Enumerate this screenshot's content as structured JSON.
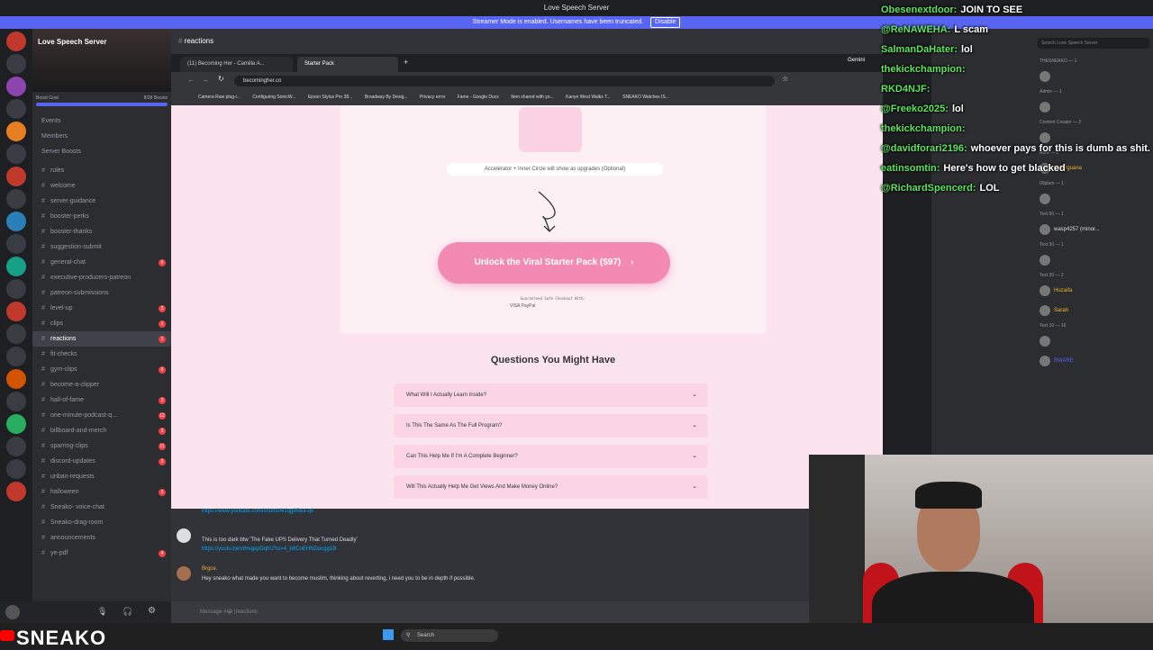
{
  "window": {
    "title": "Love Speech Server"
  },
  "streamer_banner": {
    "text": "Streamer Mode is enabled. Usernames have been truncated.",
    "disable": "Disable"
  },
  "server": {
    "name": "Love Speech Server",
    "boost_goal": "Boost Goal",
    "boost_count": "8/28 Boosts"
  },
  "nav": [
    "Events",
    "Members",
    "Server Boosts"
  ],
  "channels": [
    {
      "name": "rules",
      "count": ""
    },
    {
      "name": "welcome",
      "count": ""
    },
    {
      "name": "server-guidance",
      "count": ""
    },
    {
      "name": "booster-perks",
      "count": ""
    },
    {
      "name": "booster-thanks",
      "count": ""
    },
    {
      "name": "suggestion-submit",
      "count": ""
    },
    {
      "name": "general-chat",
      "count": "6"
    },
    {
      "name": "executive-producers-patreon",
      "count": ""
    },
    {
      "name": "patreon-submissions",
      "count": ""
    },
    {
      "name": "level-up",
      "count": "3"
    },
    {
      "name": "clips",
      "count": "1"
    },
    {
      "name": "reactions",
      "count": "1"
    },
    {
      "name": "fit-checks",
      "count": ""
    },
    {
      "name": "gym-clips",
      "count": "6"
    },
    {
      "name": "become-a-clipper",
      "count": ""
    },
    {
      "name": "hall-of-fame",
      "count": "3"
    },
    {
      "name": "one-minute-podcast-q...",
      "count": "12"
    },
    {
      "name": "billboard-and-merch",
      "count": "3"
    },
    {
      "name": "sparring-clips",
      "count": "11"
    },
    {
      "name": "discord-updates",
      "count": "3"
    },
    {
      "name": "unban-requests",
      "count": ""
    },
    {
      "name": "halloween",
      "count": "3"
    },
    {
      "name": "Sneako- voice-chat",
      "count": ""
    },
    {
      "name": "Sneako-drag-room",
      "count": ""
    },
    {
      "name": "announcements",
      "count": ""
    },
    {
      "name": "ye-pdf",
      "count": "4"
    }
  ],
  "channel_header": "reactions",
  "browser": {
    "tab1": "(11) Becoming Her - Camilla A...",
    "tab2": "Starter Pack",
    "url": "becomingher.co",
    "gemini": "Gemini",
    "bookmarks": [
      "Camera Raw plug-i...",
      "Configuring SonicW...",
      "Epson Stylus Pro 38...",
      "Broadway By Desig...",
      "Privacy error",
      "Fame - Google Docs",
      "Item shared with yo...",
      "Kanye West Walks T...",
      "SNEAKO Watches IS..."
    ]
  },
  "webpage": {
    "upgrade_note": "Accelerator + Inner Circle will show as upgrades (Optional)",
    "cta": "Unlock the Viral Starter Pack ($97)",
    "checkout_label": "Guaranteed Safe Checkout With:",
    "payments": "VISA PayPal",
    "faq_title": "Questions You Might Have",
    "faqs": [
      "What Will I Actually Learn Inside?",
      "Is This The Same As The Full Program?",
      "Can This Help Me If I'm A Complete Beginner?",
      "Will This Actually Help Me Get Views And Make Money Online?"
    ]
  },
  "chat": {
    "link1": "https://www.youtube.com/shorts/M1qg95wa-q0",
    "msg2_text": "This is too dark btw 'The Fake UPS Delivery That Turned Deadly'",
    "msg2_link": "https://youtu.be/vtHxgxpDqhU?si=4_b8CoEHNDacgg1B",
    "msg3_user": "Brgce.",
    "msg3_text": "Hey sneako what made you want to become muslim, thinking about reverting, i need you to be in depth if possible.",
    "input_placeholder": "Message #😂 |reactions"
  },
  "taskbar": {
    "search": "Search",
    "brand": "SNEAKO"
  },
  "overlay": [
    {
      "user": "Obesenextdoor:",
      "text": "JOIN TO SEE"
    },
    {
      "user": "@ReNAWEHA:",
      "text": "L scam"
    },
    {
      "user": "SalmanDaHater:",
      "text": "lol"
    },
    {
      "user": "thekickchampion:",
      "text": ""
    },
    {
      "user": "RKD4NJF:",
      "text": ""
    },
    {
      "user": "@Freeko2025:",
      "text": "lol"
    },
    {
      "user": "thekickchampion:",
      "text": ""
    },
    {
      "user": "@davidforari2196:",
      "text": "whoever pays for this is dumb as shit."
    },
    {
      "user": "eatinsomtin:",
      "text": "Here's how to get blacked"
    },
    {
      "user": "@RichardSpencerd:",
      "text": "LOL"
    }
  ],
  "members": {
    "search": "Search Love Speech Server",
    "groups": [
      "THESNEAKO — 1",
      "Admin — 1",
      "Content Creator — 2",
      "Aura — 1",
      "00plum — 1",
      "Text 50 — 1",
      "Text 30 — 1",
      "Text 20 — 2",
      "Text 10 — 16"
    ],
    "names": [
      "Silly Iguana",
      "wasp4257 (minor...",
      "Huzaifa",
      "Sarah",
      "BWARE"
    ]
  },
  "colors": {
    "accent": "#f38ab4",
    "discord_blurple": "#5865f2",
    "page_bg": "#fce4ef"
  }
}
